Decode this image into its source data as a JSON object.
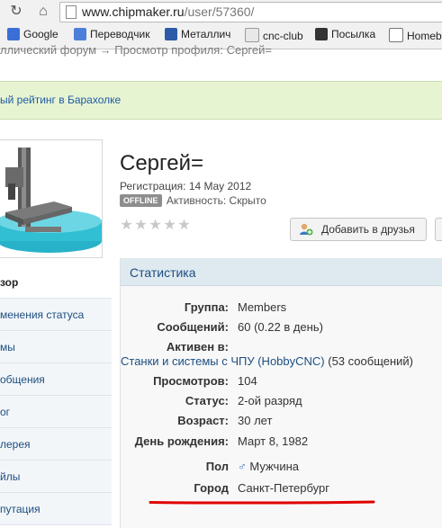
{
  "browser": {
    "url_host": "www.chipmaker.ru",
    "url_path": "/user/57360/",
    "bookmarks": [
      "Google",
      "Переводчик",
      "Металлич",
      "cnc-club",
      "Посылка",
      "Homeb"
    ]
  },
  "breadcrumb": "ллический форум  →  Просмотр профиля: Сергей=",
  "banner_link": "ый рейтинг в Барахолке",
  "profile": {
    "name": "Сергей=",
    "registration": "Регистрация: 14 May 2012",
    "offline_badge": "OFFLINE",
    "activity": "Активность: Скрыто",
    "rating_stars": 0,
    "add_friend_label": "Добавить в друзья"
  },
  "sidebar": {
    "items": [
      "зор",
      "менения статуса",
      "мы",
      "общения",
      "ог",
      "лерея",
      "йлы",
      "путация"
    ]
  },
  "stats": {
    "title": "Статистика",
    "rows": [
      {
        "label": "Группа:",
        "value": "Members"
      },
      {
        "label": "Сообщений:",
        "value": "60 (0.22 в день)"
      },
      {
        "label": "Активен в:",
        "value": ""
      },
      {
        "label": "Просмотров:",
        "value": "104"
      },
      {
        "label": "Статус:",
        "value": "2-ой разряд"
      },
      {
        "label": "Возраст:",
        "value": "30 лет"
      },
      {
        "label": "День рождения:",
        "value": "Март 8, 1982"
      },
      {
        "label": "Пол",
        "value": "Мужчина"
      },
      {
        "label": "Город",
        "value": "Санкт-Петербург"
      }
    ],
    "active_in_link": "Станки и системы с ЧПУ (HobbyCNC)",
    "active_in_count": "(53 сообщений)"
  },
  "colors": {
    "banner_bg": "#e6f4d2",
    "link": "#1c4e80",
    "annotation": "#e00000"
  }
}
